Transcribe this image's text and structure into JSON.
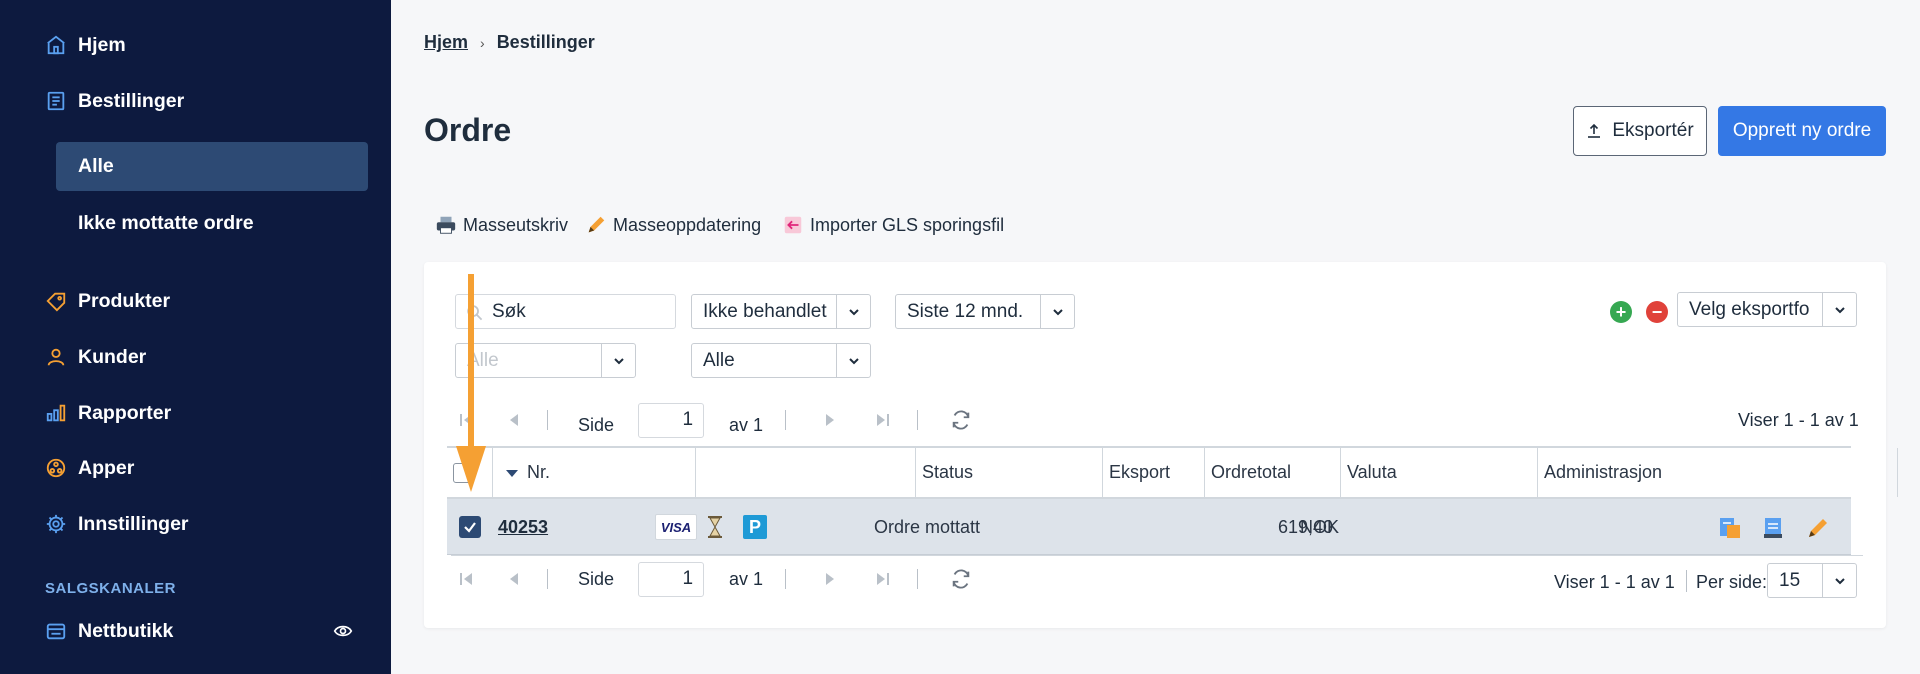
{
  "sidebar": {
    "items": [
      {
        "label": "Hjem",
        "icon": "home-icon"
      },
      {
        "label": "Bestillinger",
        "icon": "orders-icon"
      },
      {
        "label": "Produkter",
        "icon": "tag-icon"
      },
      {
        "label": "Kunder",
        "icon": "user-icon"
      },
      {
        "label": "Rapporter",
        "icon": "bar-chart-icon"
      },
      {
        "label": "Apper",
        "icon": "apps-icon"
      },
      {
        "label": "Innstillinger",
        "icon": "gear-icon"
      }
    ],
    "sub_items": [
      {
        "label": "Alle",
        "active": true
      },
      {
        "label": "Ikke mottatte ordre",
        "active": false
      }
    ],
    "section_label": "SALGSKANALER",
    "channel": {
      "label": "Nettbutikk",
      "icon": "storefront-icon"
    }
  },
  "breadcrumb": {
    "home": "Hjem",
    "current": "Bestillinger"
  },
  "page": {
    "title": "Ordre"
  },
  "buttons": {
    "export": "Eksportér",
    "new_order": "Opprett ny ordre"
  },
  "actions": {
    "mass_print": "Masseutskriv",
    "mass_update": "Masseoppdatering",
    "import_gls": "Importer GLS sporingsfil"
  },
  "filters": {
    "search_value": "Søk",
    "status_select": "Ikke behandlet",
    "period_select": "Siste 12 mnd.",
    "export_format": "Velg eksportfo",
    "filter3_placeholder": "Alle",
    "filter4_select": "Alle"
  },
  "pager": {
    "side_label": "Side",
    "page": "1",
    "of_label": "av 1",
    "viser": "Viser 1 - 1 av 1",
    "per_page_label": "Per side:",
    "per_page": "15"
  },
  "table": {
    "columns": [
      "Nr.",
      "",
      "Status",
      "Eksport",
      "Ordretotal",
      "Valuta",
      "Administrasjon"
    ],
    "rows": [
      {
        "nr": "40253",
        "payment": "VISA",
        "status": "Ordre mottatt",
        "export": "",
        "total": "619,40",
        "currency": "NOK"
      }
    ]
  },
  "colors": {
    "sidebar_bg": "#0d1a3f",
    "accent": "#3478e5",
    "active_item": "#2d4a74",
    "arrow": "#f5a033"
  }
}
